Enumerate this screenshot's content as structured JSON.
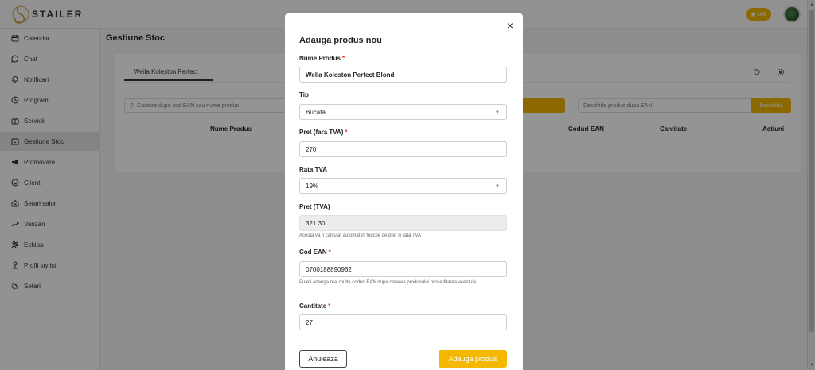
{
  "app": {
    "logo_text": "STAILER",
    "coins": "188",
    "page_title": "Gestiune Stoc"
  },
  "sidebar": {
    "items": [
      {
        "label": "Calendar",
        "icon": "calendar-icon"
      },
      {
        "label": "Chat",
        "icon": "chat-icon"
      },
      {
        "label": "Notificari",
        "icon": "bell-icon"
      },
      {
        "label": "Program",
        "icon": "clock-icon"
      },
      {
        "label": "Servicii",
        "icon": "briefcase-icon"
      },
      {
        "label": "Gestiune Stoc",
        "icon": "box-icon",
        "active": true
      },
      {
        "label": "Promovare",
        "icon": "megaphone-icon"
      },
      {
        "label": "Clienti",
        "icon": "smiley-icon"
      },
      {
        "label": "Setari salon",
        "icon": "home-icon"
      },
      {
        "label": "Vanzari",
        "icon": "trend-icon"
      },
      {
        "label": "Echipa",
        "icon": "team-icon"
      },
      {
        "label": "Profil stylist",
        "icon": "user-icon"
      },
      {
        "label": "Setari",
        "icon": "gear-icon"
      }
    ]
  },
  "stock": {
    "tab": "Weila Koleston Perfect",
    "search_placeholder": "Cautare dupa cod EAN sau nume produs",
    "ean_placeholder": "Deschide produs dupa EAN",
    "ean_button": "Deschide",
    "columns": [
      "Nume Produs",
      "Coduri EAN",
      "Cantitate",
      "Actiuni"
    ]
  },
  "modal": {
    "title": "Adauga produs nou",
    "close": "×",
    "fields": {
      "name": {
        "label": "Nume Produs",
        "value": "Wella Koleston Perfect Blond"
      },
      "type": {
        "label": "Tip",
        "value": "Bucata"
      },
      "price": {
        "label": "Pret (fara TVA)",
        "value": "270"
      },
      "vat_rate": {
        "label": "Rata TVA",
        "value": "19%"
      },
      "price_vat": {
        "label": "Pret (TVA)",
        "value": "321.30",
        "helper": "Acesta va fi calculat automat in functie de pret si rata TVA"
      },
      "ean": {
        "label": "Cod EAN",
        "value": "0700188890962",
        "helper": "Puteti adauga mai multe coduri EAN dupa crearea produsului prin editarea acestuia."
      },
      "quantity": {
        "label": "Cantitate",
        "value": "27"
      }
    },
    "required_mark": "*",
    "cancel_label": "Anuleaza",
    "submit_label": "Adauga produs"
  },
  "colors": {
    "accent": "#f5b800",
    "required": "#e53935"
  }
}
